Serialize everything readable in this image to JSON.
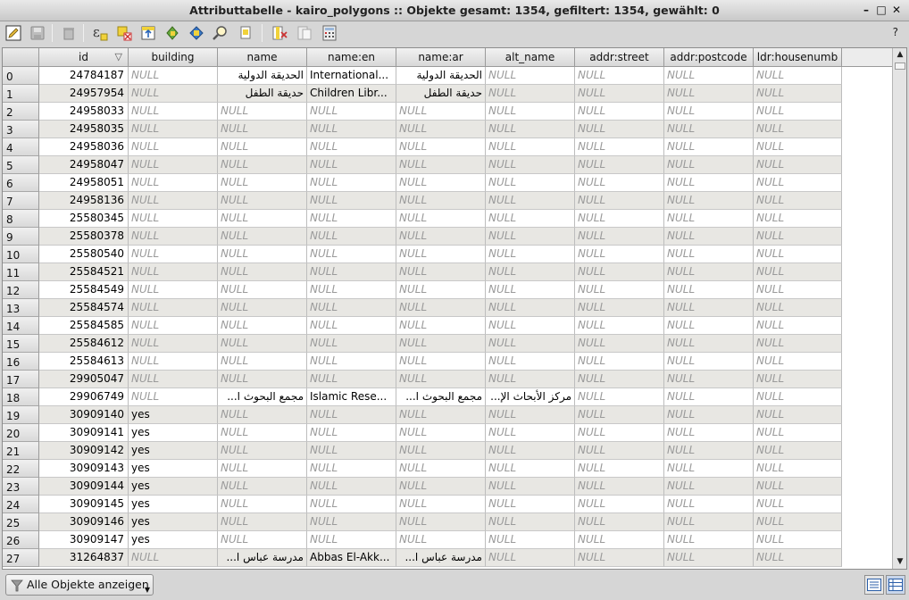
{
  "window": {
    "title": "Attributtabelle - kairo_polygons :: Objekte gesamt: 1354, gefiltert: 1354, gewählt: 0",
    "minimize_glyph": "–",
    "maximize_glyph": "□",
    "close_glyph": "✕"
  },
  "toolbar": {
    "help_label": "?",
    "icons": [
      "edit-pencil-icon",
      "save-icon",
      "delete-icon",
      "expression-select-icon",
      "select-all-icon",
      "move-selection-top-icon",
      "invert-selection-icon",
      "deselect-all-icon",
      "zoom-to-selection-icon",
      "copy-rows-icon",
      "delete-column-icon",
      "new-column-icon",
      "field-calculator-icon"
    ]
  },
  "table": {
    "sort_indicator": "▽",
    "columns": [
      "id",
      "building",
      "name",
      "name:en",
      "name:ar",
      "alt_name",
      "addr:street",
      "addr:postcode",
      "ldr:housenumb"
    ],
    "rows": [
      {
        "n": "0",
        "id": "24784187",
        "building": "NULL",
        "name": "الحديقة الدولية",
        "name_en": "International...",
        "name_ar": "الحديقة الدولية",
        "alt_name": "NULL",
        "street": "NULL",
        "postcode": "NULL",
        "housenumber": "NULL"
      },
      {
        "n": "1",
        "id": "24957954",
        "building": "NULL",
        "name": "حديقة الطفل",
        "name_en": "Children Libr...",
        "name_ar": "حديقة الطفل",
        "alt_name": "NULL",
        "street": "NULL",
        "postcode": "NULL",
        "housenumber": "NULL"
      },
      {
        "n": "2",
        "id": "24958033",
        "building": "NULL",
        "name": "NULL",
        "name_en": "NULL",
        "name_ar": "NULL",
        "alt_name": "NULL",
        "street": "NULL",
        "postcode": "NULL",
        "housenumber": "NULL"
      },
      {
        "n": "3",
        "id": "24958035",
        "building": "NULL",
        "name": "NULL",
        "name_en": "NULL",
        "name_ar": "NULL",
        "alt_name": "NULL",
        "street": "NULL",
        "postcode": "NULL",
        "housenumber": "NULL"
      },
      {
        "n": "4",
        "id": "24958036",
        "building": "NULL",
        "name": "NULL",
        "name_en": "NULL",
        "name_ar": "NULL",
        "alt_name": "NULL",
        "street": "NULL",
        "postcode": "NULL",
        "housenumber": "NULL"
      },
      {
        "n": "5",
        "id": "24958047",
        "building": "NULL",
        "name": "NULL",
        "name_en": "NULL",
        "name_ar": "NULL",
        "alt_name": "NULL",
        "street": "NULL",
        "postcode": "NULL",
        "housenumber": "NULL"
      },
      {
        "n": "6",
        "id": "24958051",
        "building": "NULL",
        "name": "NULL",
        "name_en": "NULL",
        "name_ar": "NULL",
        "alt_name": "NULL",
        "street": "NULL",
        "postcode": "NULL",
        "housenumber": "NULL"
      },
      {
        "n": "7",
        "id": "24958136",
        "building": "NULL",
        "name": "NULL",
        "name_en": "NULL",
        "name_ar": "NULL",
        "alt_name": "NULL",
        "street": "NULL",
        "postcode": "NULL",
        "housenumber": "NULL"
      },
      {
        "n": "8",
        "id": "25580345",
        "building": "NULL",
        "name": "NULL",
        "name_en": "NULL",
        "name_ar": "NULL",
        "alt_name": "NULL",
        "street": "NULL",
        "postcode": "NULL",
        "housenumber": "NULL"
      },
      {
        "n": "9",
        "id": "25580378",
        "building": "NULL",
        "name": "NULL",
        "name_en": "NULL",
        "name_ar": "NULL",
        "alt_name": "NULL",
        "street": "NULL",
        "postcode": "NULL",
        "housenumber": "NULL"
      },
      {
        "n": "10",
        "id": "25580540",
        "building": "NULL",
        "name": "NULL",
        "name_en": "NULL",
        "name_ar": "NULL",
        "alt_name": "NULL",
        "street": "NULL",
        "postcode": "NULL",
        "housenumber": "NULL"
      },
      {
        "n": "11",
        "id": "25584521",
        "building": "NULL",
        "name": "NULL",
        "name_en": "NULL",
        "name_ar": "NULL",
        "alt_name": "NULL",
        "street": "NULL",
        "postcode": "NULL",
        "housenumber": "NULL"
      },
      {
        "n": "12",
        "id": "25584549",
        "building": "NULL",
        "name": "NULL",
        "name_en": "NULL",
        "name_ar": "NULL",
        "alt_name": "NULL",
        "street": "NULL",
        "postcode": "NULL",
        "housenumber": "NULL"
      },
      {
        "n": "13",
        "id": "25584574",
        "building": "NULL",
        "name": "NULL",
        "name_en": "NULL",
        "name_ar": "NULL",
        "alt_name": "NULL",
        "street": "NULL",
        "postcode": "NULL",
        "housenumber": "NULL"
      },
      {
        "n": "14",
        "id": "25584585",
        "building": "NULL",
        "name": "NULL",
        "name_en": "NULL",
        "name_ar": "NULL",
        "alt_name": "NULL",
        "street": "NULL",
        "postcode": "NULL",
        "housenumber": "NULL"
      },
      {
        "n": "15",
        "id": "25584612",
        "building": "NULL",
        "name": "NULL",
        "name_en": "NULL",
        "name_ar": "NULL",
        "alt_name": "NULL",
        "street": "NULL",
        "postcode": "NULL",
        "housenumber": "NULL"
      },
      {
        "n": "16",
        "id": "25584613",
        "building": "NULL",
        "name": "NULL",
        "name_en": "NULL",
        "name_ar": "NULL",
        "alt_name": "NULL",
        "street": "NULL",
        "postcode": "NULL",
        "housenumber": "NULL"
      },
      {
        "n": "17",
        "id": "29905047",
        "building": "NULL",
        "name": "NULL",
        "name_en": "NULL",
        "name_ar": "NULL",
        "alt_name": "NULL",
        "street": "NULL",
        "postcode": "NULL",
        "housenumber": "NULL"
      },
      {
        "n": "18",
        "id": "29906749",
        "building": "NULL",
        "name": "مجمع البحوث ا...",
        "name_en": "Islamic Rese...",
        "name_ar": "مجمع البحوث ا...",
        "alt_name": "مركز الأبحاث الإ...",
        "street": "NULL",
        "postcode": "NULL",
        "housenumber": "NULL"
      },
      {
        "n": "19",
        "id": "30909140",
        "building": "yes",
        "name": "NULL",
        "name_en": "NULL",
        "name_ar": "NULL",
        "alt_name": "NULL",
        "street": "NULL",
        "postcode": "NULL",
        "housenumber": "NULL"
      },
      {
        "n": "20",
        "id": "30909141",
        "building": "yes",
        "name": "NULL",
        "name_en": "NULL",
        "name_ar": "NULL",
        "alt_name": "NULL",
        "street": "NULL",
        "postcode": "NULL",
        "housenumber": "NULL"
      },
      {
        "n": "21",
        "id": "30909142",
        "building": "yes",
        "name": "NULL",
        "name_en": "NULL",
        "name_ar": "NULL",
        "alt_name": "NULL",
        "street": "NULL",
        "postcode": "NULL",
        "housenumber": "NULL"
      },
      {
        "n": "22",
        "id": "30909143",
        "building": "yes",
        "name": "NULL",
        "name_en": "NULL",
        "name_ar": "NULL",
        "alt_name": "NULL",
        "street": "NULL",
        "postcode": "NULL",
        "housenumber": "NULL"
      },
      {
        "n": "23",
        "id": "30909144",
        "building": "yes",
        "name": "NULL",
        "name_en": "NULL",
        "name_ar": "NULL",
        "alt_name": "NULL",
        "street": "NULL",
        "postcode": "NULL",
        "housenumber": "NULL"
      },
      {
        "n": "24",
        "id": "30909145",
        "building": "yes",
        "name": "NULL",
        "name_en": "NULL",
        "name_ar": "NULL",
        "alt_name": "NULL",
        "street": "NULL",
        "postcode": "NULL",
        "housenumber": "NULL"
      },
      {
        "n": "25",
        "id": "30909146",
        "building": "yes",
        "name": "NULL",
        "name_en": "NULL",
        "name_ar": "NULL",
        "alt_name": "NULL",
        "street": "NULL",
        "postcode": "NULL",
        "housenumber": "NULL"
      },
      {
        "n": "26",
        "id": "30909147",
        "building": "yes",
        "name": "NULL",
        "name_en": "NULL",
        "name_ar": "NULL",
        "alt_name": "NULL",
        "street": "NULL",
        "postcode": "NULL",
        "housenumber": "NULL"
      },
      {
        "n": "27",
        "id": "31264837",
        "building": "NULL",
        "name": "مدرسة عباس ا...",
        "name_en": "Abbas El-Akk...",
        "name_ar": "مدرسة عباس ا...",
        "alt_name": "NULL",
        "street": "NULL",
        "postcode": "NULL",
        "housenumber": "NULL"
      }
    ]
  },
  "scrollbar": {
    "up_glyph": "▲",
    "down_glyph": "▼"
  },
  "bottom": {
    "filter_label": "Alle Objekte anzeigen",
    "dropdown_glyph": "▼"
  },
  "colors": {
    "null_text": "#9b9b9b",
    "alt_row": "#e8e7e3",
    "header_bg": "#d8d8d8"
  }
}
